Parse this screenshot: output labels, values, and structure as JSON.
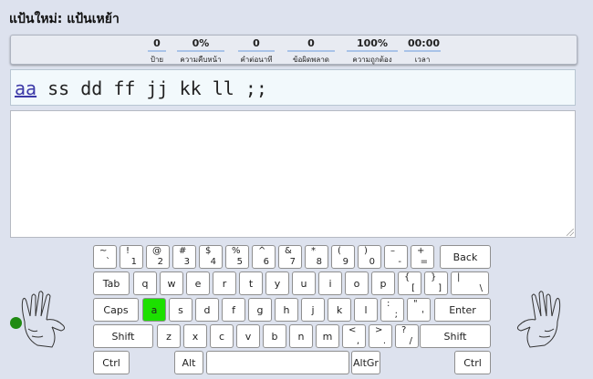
{
  "header": {
    "title": "แป้นใหม่: แป้นเหย้า"
  },
  "stats": [
    {
      "value": "0",
      "label": "ป้าย"
    },
    {
      "value": "0%",
      "label": "ความคืบหน้า"
    },
    {
      "value": "0",
      "label": "คำต่อนาที"
    },
    {
      "value": "0",
      "label": "ข้อผิดพลาด"
    },
    {
      "value": "100%",
      "label": "ความถูกต้อง"
    },
    {
      "value": "00:00",
      "label": "เวลา"
    }
  ],
  "practice": {
    "typed": "aa",
    "remaining": " ss dd ff jj kk ll ;;"
  },
  "typing_area": {
    "value": ""
  },
  "keyboard": {
    "highlight_color": "#1ce000",
    "highlighted_key": "a",
    "row1": [
      [
        "~",
        "`"
      ],
      [
        "!",
        "1"
      ],
      [
        "@",
        "2"
      ],
      [
        "#",
        "3"
      ],
      [
        "$",
        "4"
      ],
      [
        "%",
        "5"
      ],
      [
        "^",
        "6"
      ],
      [
        "&",
        "7"
      ],
      [
        "*",
        "8"
      ],
      [
        "(",
        "9"
      ],
      [
        ")",
        "0"
      ],
      [
        "–",
        "-"
      ],
      [
        "+",
        "="
      ]
    ],
    "row2": [
      "q",
      "w",
      "e",
      "r",
      "t",
      "y",
      "u",
      "i",
      "o",
      "p"
    ],
    "row2_brackets": [
      [
        "{",
        "["
      ],
      [
        "}",
        "]"
      ],
      [
        "|",
        "\\"
      ]
    ],
    "row3": [
      "a",
      "s",
      "d",
      "f",
      "g",
      "h",
      "j",
      "k",
      "l"
    ],
    "row3_punct": [
      [
        ":",
        ";"
      ],
      [
        "\"",
        "'"
      ]
    ],
    "row4": [
      "z",
      "x",
      "c",
      "v",
      "b",
      "n",
      "m"
    ],
    "row4_punct": [
      [
        "<",
        ","
      ],
      [
        ">",
        "."
      ],
      [
        "?",
        "/"
      ]
    ],
    "labels": {
      "backspace": "Back",
      "tab": "Tab",
      "caps": "Caps",
      "enter": "Enter",
      "shift_left": "Shift",
      "shift_right": "Shift",
      "ctrl_left": "Ctrl",
      "alt": "Alt",
      "altgr": "AltGr",
      "ctrl_right": "Ctrl"
    }
  },
  "hands": {
    "left_icon": "left-hand-icon",
    "right_icon": "right-hand-icon",
    "indicator_color": "#1f8a12"
  }
}
